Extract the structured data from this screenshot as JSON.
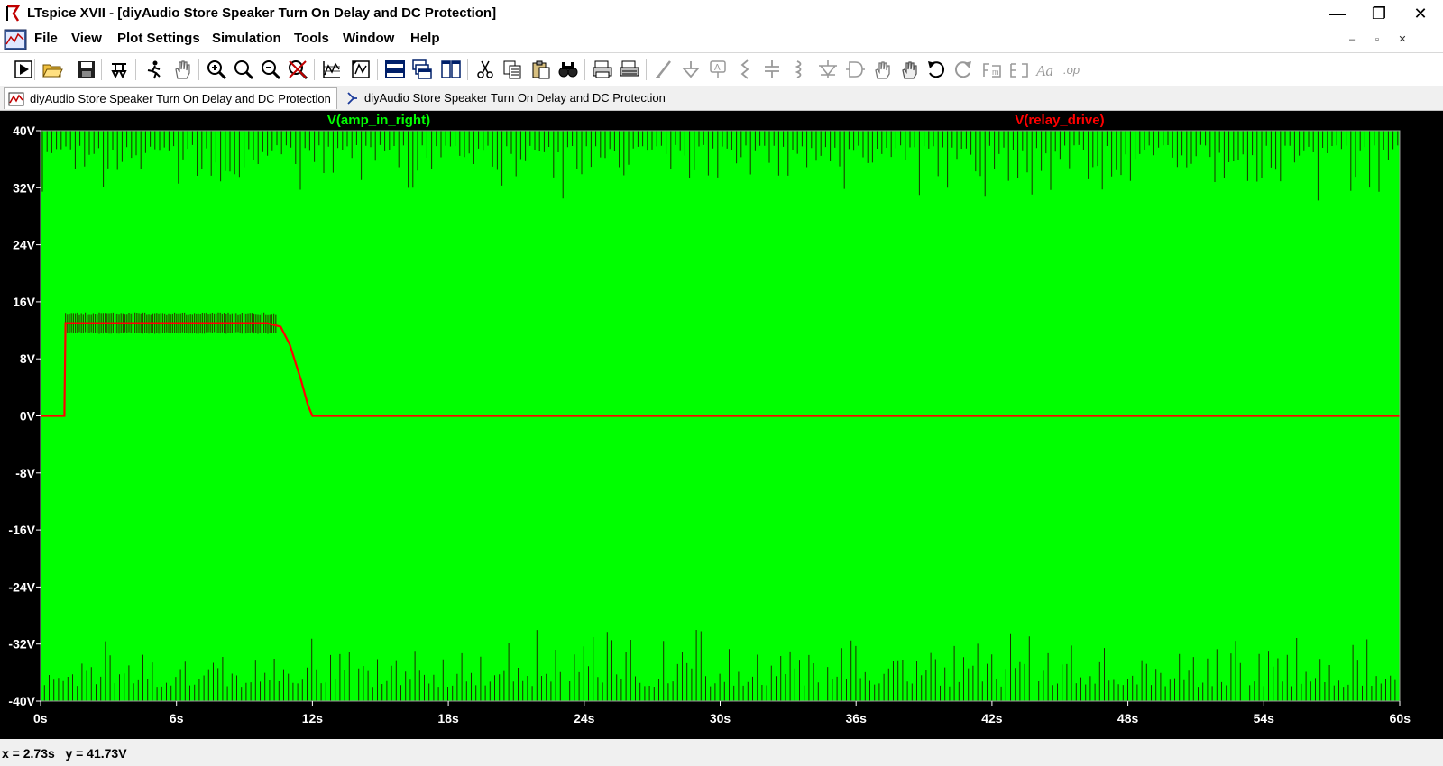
{
  "window": {
    "title": "LTspice XVII - [diyAudio Store Speaker Turn On Delay and DC Protection]",
    "minimize_glyph": "—",
    "maximize_glyph": "❐",
    "close_glyph": "✕",
    "mdi_min_glyph": "–",
    "mdi_restore_glyph": "▫",
    "mdi_close_glyph": "✕"
  },
  "menu": [
    {
      "label": "File"
    },
    {
      "label": "View"
    },
    {
      "label": "Plot Settings"
    },
    {
      "label": "Simulation"
    },
    {
      "label": "Tools"
    },
    {
      "label": "Window"
    },
    {
      "label": "Help"
    }
  ],
  "toolbar_icons": [
    "run-icon",
    "open-icon",
    "save-icon",
    "control-panel-icon",
    "halt-icon",
    "pan-icon",
    "zoom-in-icon",
    "zoom-icon",
    "zoom-out-icon",
    "zoom-cancel-icon",
    "autorange-icon",
    "mark-icon",
    "tile-horizontal-icon",
    "cascade-icon",
    "tile-vertical-icon",
    "cut-icon",
    "copy-icon",
    "paste-icon",
    "find-icon",
    "print-icon",
    "print-setup-icon",
    "wire-icon",
    "ground-icon",
    "label-icon",
    "resistor-icon",
    "capacitor-icon",
    "inductor-icon",
    "diode-icon",
    "component-icon",
    "move-icon",
    "drag-icon",
    "undo-icon",
    "redo-icon",
    "rotate-icon",
    "mirror-icon",
    "text-icon",
    "spice-directive-icon"
  ],
  "tabs": [
    {
      "label": "diyAudio Store Speaker Turn On Delay and DC Protection",
      "icon": "waveform-doc-icon"
    },
    {
      "label": "diyAudio Store Speaker Turn On Delay and DC Protection",
      "icon": "schematic-doc-icon"
    }
  ],
  "colors": {
    "plot_bg": "#000000",
    "trace_green": "#00ff00",
    "trace_red": "#ff0000",
    "axis_text": "#ffffff",
    "dark_trace": "#2e4a00"
  },
  "chart_data": {
    "type": "line",
    "x_range": [
      0,
      60
    ],
    "y_range": [
      -40,
      40
    ],
    "x_ticks": [
      "0s",
      "6s",
      "12s",
      "18s",
      "24s",
      "30s",
      "36s",
      "42s",
      "48s",
      "54s",
      "60s"
    ],
    "y_ticks": [
      "40V",
      "32V",
      "24V",
      "16V",
      "8V",
      "0V",
      "-8V",
      "-16V",
      "-24V",
      "-32V",
      "-40V"
    ],
    "series": [
      {
        "name": "V(amp_in_right)",
        "color": "#00ff00",
        "envelope": {
          "min": -40,
          "max": 40
        },
        "peak_spikes_top_to": 30,
        "peak_spikes_bottom_to": -29
      },
      {
        "name": "V(relay_drive)",
        "color": "#ff0000",
        "x": [
          0,
          1.05,
          1.1,
          2,
          6,
          10,
          10.6,
          11,
          11.5,
          11.8,
          12,
          60
        ],
        "y": [
          0,
          0,
          13,
          13,
          13,
          13,
          12.5,
          10,
          5,
          1.5,
          0,
          0
        ],
        "ripple": 1.5
      }
    ]
  },
  "status": {
    "text": "x = 2.73s   y = 41.73V"
  }
}
